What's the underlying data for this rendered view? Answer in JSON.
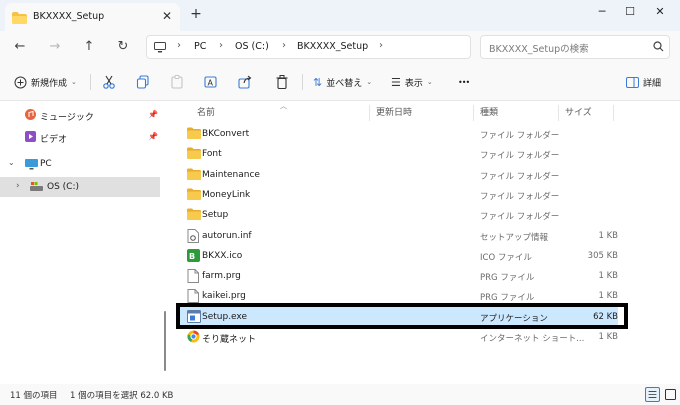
{
  "window": {
    "tab_title": "BKXXXX_Setup",
    "new_tab": "+",
    "controls": {
      "minimize": "─",
      "maximize": "☐",
      "close": "✕"
    }
  },
  "nav": {
    "back": "←",
    "forward": "→",
    "up": "↑",
    "refresh": "↻",
    "breadcrumb": [
      "PC",
      "OS (C:)",
      "BKXXXX_Setup"
    ],
    "search_placeholder": "BKXXXX_Setupの検索"
  },
  "toolbar": {
    "new_label": "新規作成",
    "sort_label": "並べ替え",
    "view_label": "表示",
    "more": "•••",
    "details_label": "詳細"
  },
  "sidebar": {
    "items": [
      {
        "label": "ミュージック",
        "icon": "music-icon",
        "pinned": true
      },
      {
        "label": "ビデオ",
        "icon": "video-icon",
        "pinned": true
      },
      {
        "label": "PC",
        "icon": "pc-icon",
        "expanded": true
      },
      {
        "label": "OS (C:)",
        "icon": "drive-icon",
        "selected": true
      }
    ]
  },
  "columns": {
    "name": "名前",
    "date": "更新日時",
    "type": "種類",
    "size": "サイズ"
  },
  "files": [
    {
      "name": "BKConvert",
      "type": "ファイル フォルダー",
      "size": "",
      "icon": "folder-icon"
    },
    {
      "name": "Font",
      "type": "ファイル フォルダー",
      "size": "",
      "icon": "folder-icon"
    },
    {
      "name": "Maintenance",
      "type": "ファイル フォルダー",
      "size": "",
      "icon": "folder-icon"
    },
    {
      "name": "MoneyLink",
      "type": "ファイル フォルダー",
      "size": "",
      "icon": "folder-icon"
    },
    {
      "name": "Setup",
      "type": "ファイル フォルダー",
      "size": "",
      "icon": "folder-icon"
    },
    {
      "name": "autorun.inf",
      "type": "セットアップ情報",
      "size": "1 KB",
      "icon": "setup-info-icon"
    },
    {
      "name": "BKXX.ico",
      "type": "ICO ファイル",
      "size": "305 KB",
      "icon": "ico-file-icon"
    },
    {
      "name": "farm.prg",
      "type": "PRG ファイル",
      "size": "1 KB",
      "icon": "file-icon"
    },
    {
      "name": "kaikei.prg",
      "type": "PRG ファイル",
      "size": "1 KB",
      "icon": "file-icon"
    },
    {
      "name": "Setup.exe",
      "type": "アプリケーション",
      "size": "62 KB",
      "icon": "exe-icon",
      "selected": true
    },
    {
      "name": "そり蔵ネット",
      "type": "インターネット ショート...",
      "size": "1 KB",
      "icon": "internet-shortcut-icon"
    }
  ],
  "status": {
    "count": "11 個の項目",
    "selection": "1 個の項目を選択  62.0 KB"
  },
  "colors": {
    "selection": "#cce8ff",
    "folder": "#f5c244",
    "highlight_border": "#000000"
  }
}
